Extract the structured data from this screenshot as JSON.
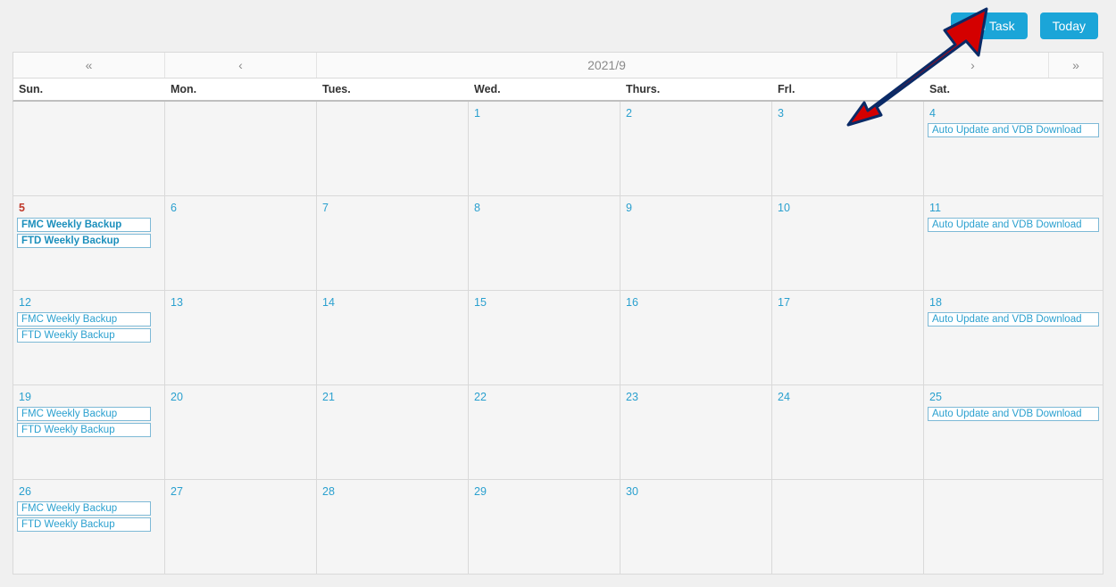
{
  "actions": {
    "add_task": "Add Task",
    "today": "Today"
  },
  "nav": {
    "prev_year_glyph": "«",
    "prev_month_glyph": "‹",
    "title": "2021/9",
    "next_month_glyph": "›",
    "next_year_glyph": "»"
  },
  "day_labels": [
    "Sun.",
    "Mon.",
    "Tues.",
    "Wed.",
    "Thurs.",
    "Frl.",
    "Sat."
  ],
  "today_day": 5,
  "weeks": [
    [
      {
        "day": null,
        "events": []
      },
      {
        "day": null,
        "events": []
      },
      {
        "day": null,
        "events": []
      },
      {
        "day": 1,
        "events": []
      },
      {
        "day": 2,
        "events": []
      },
      {
        "day": 3,
        "events": []
      },
      {
        "day": 4,
        "events": [
          "Auto Update and VDB Download"
        ]
      }
    ],
    [
      {
        "day": 5,
        "events": [
          "FMC Weekly Backup",
          "FTD Weekly Backup"
        ]
      },
      {
        "day": 6,
        "events": []
      },
      {
        "day": 7,
        "events": []
      },
      {
        "day": 8,
        "events": []
      },
      {
        "day": 9,
        "events": []
      },
      {
        "day": 10,
        "events": []
      },
      {
        "day": 11,
        "events": [
          "Auto Update and VDB Download"
        ]
      }
    ],
    [
      {
        "day": 12,
        "events": [
          "FMC Weekly Backup",
          "FTD Weekly Backup"
        ]
      },
      {
        "day": 13,
        "events": []
      },
      {
        "day": 14,
        "events": []
      },
      {
        "day": 15,
        "events": []
      },
      {
        "day": 16,
        "events": []
      },
      {
        "day": 17,
        "events": []
      },
      {
        "day": 18,
        "events": [
          "Auto Update and VDB Download"
        ]
      }
    ],
    [
      {
        "day": 19,
        "events": [
          "FMC Weekly Backup",
          "FTD Weekly Backup"
        ]
      },
      {
        "day": 20,
        "events": []
      },
      {
        "day": 21,
        "events": []
      },
      {
        "day": 22,
        "events": []
      },
      {
        "day": 23,
        "events": []
      },
      {
        "day": 24,
        "events": []
      },
      {
        "day": 25,
        "events": [
          "Auto Update and VDB Download"
        ]
      }
    ],
    [
      {
        "day": 26,
        "events": [
          "FMC Weekly Backup",
          "FTD Weekly Backup"
        ]
      },
      {
        "day": 27,
        "events": []
      },
      {
        "day": 28,
        "events": []
      },
      {
        "day": 29,
        "events": []
      },
      {
        "day": 30,
        "events": []
      },
      {
        "day": null,
        "events": []
      },
      {
        "day": null,
        "events": []
      }
    ]
  ],
  "annotation": {
    "type": "arrow",
    "color": "#d40000",
    "target": "add-task-button"
  }
}
